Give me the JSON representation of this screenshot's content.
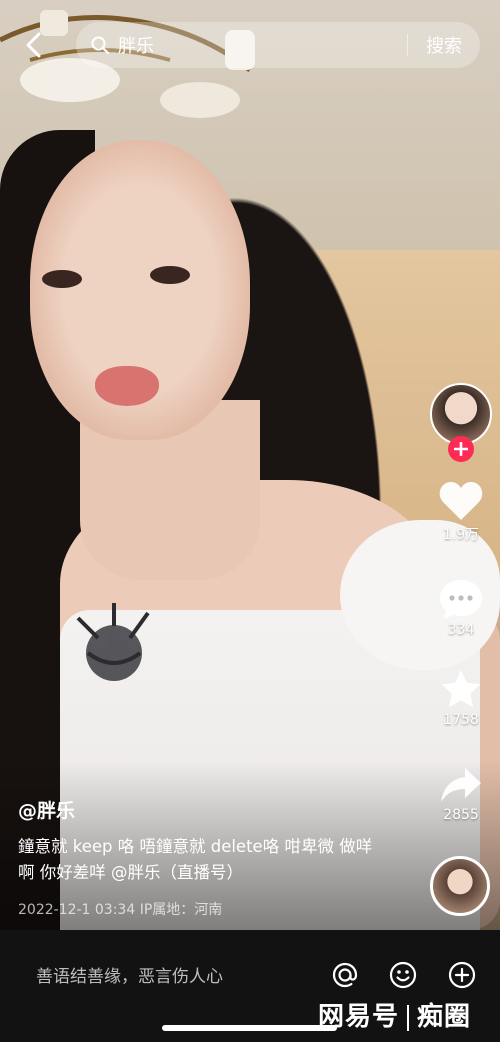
{
  "search": {
    "query": "胖乐",
    "button_label": "搜索"
  },
  "rail": {
    "likes": "1.9万",
    "comments": "334",
    "favorites": "1758",
    "shares": "2855"
  },
  "post": {
    "author": "@胖乐",
    "caption": "鐘意就 keep 咯 唔鐘意就 delete咯 咁卑微 做咩啊 你好差咩 @胖乐（直播号）",
    "meta": "2022-12-1 03:34 IP属地：河南"
  },
  "comment_bar": {
    "placeholder": "善语结善缘，恶言伤人心"
  },
  "watermark": {
    "left": "网易号",
    "right": "痴圈"
  },
  "icons": [
    "back-arrow-icon",
    "search-icon",
    "heart-icon",
    "comment-icon",
    "star-icon",
    "share-icon",
    "at-icon",
    "emoji-icon",
    "plus-icon"
  ],
  "colors": {
    "follow": "#fe2c55",
    "bar": "#121212"
  }
}
